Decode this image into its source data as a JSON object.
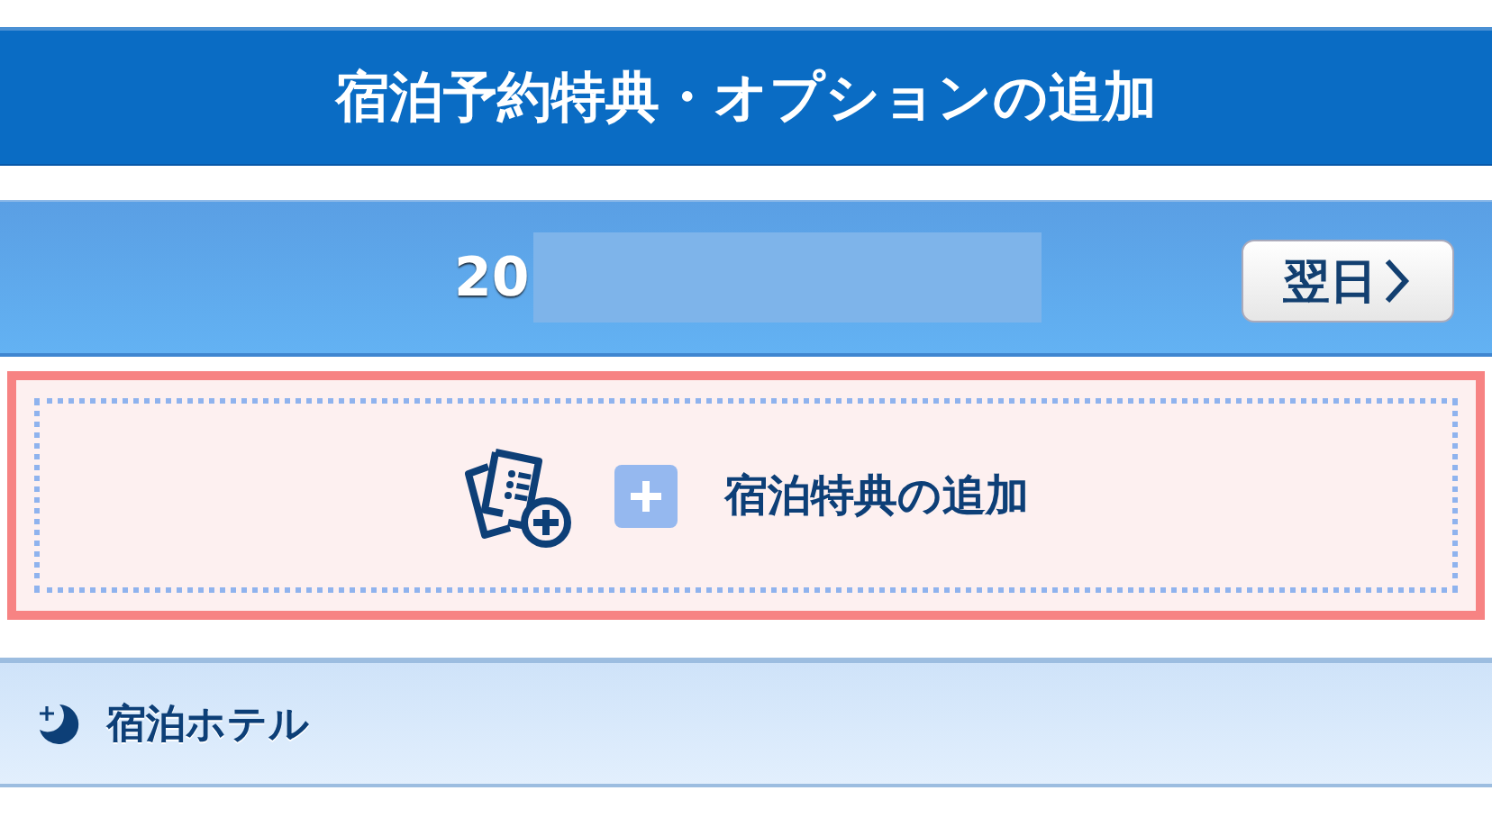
{
  "header": {
    "title": "宿泊予約特典・オプションの追加"
  },
  "date_bar": {
    "date": "20",
    "next_button": "翌日"
  },
  "add_benefit": {
    "label": "宿泊特典の追加"
  },
  "section": {
    "title": "宿泊ホテル"
  }
}
